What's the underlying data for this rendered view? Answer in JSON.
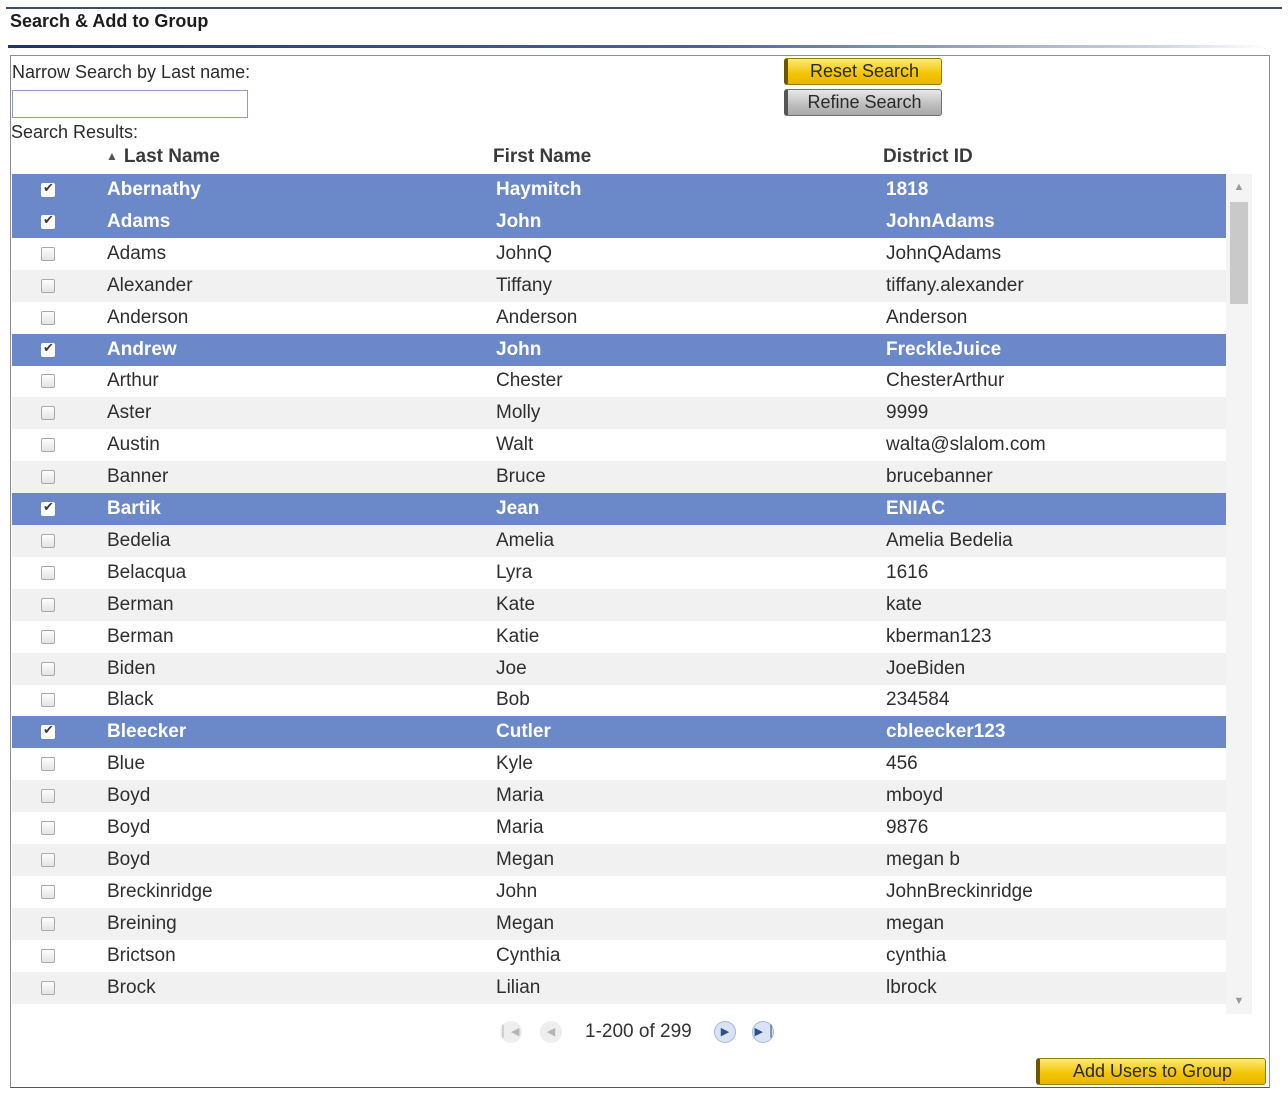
{
  "header": {
    "title": "Search & Add to Group"
  },
  "search": {
    "narrow_label": "Narrow Search by Last name:",
    "input_value": "",
    "reset_label": "Reset Search",
    "refine_label": "Refine Search",
    "results_label": "Search Results:"
  },
  "table": {
    "columns": [
      "Last Name",
      "First Name",
      "District ID"
    ],
    "sort_column": "Last Name",
    "sort_direction": "ascending",
    "rows": [
      {
        "last": "Abernathy",
        "first": "Haymitch",
        "id": "1818",
        "selected": true
      },
      {
        "last": "Adams",
        "first": "John",
        "id": "JohnAdams",
        "selected": true
      },
      {
        "last": "Adams",
        "first": "JohnQ",
        "id": "JohnQAdams",
        "selected": false
      },
      {
        "last": "Alexander",
        "first": "Tiffany",
        "id": "tiffany.alexander",
        "selected": false
      },
      {
        "last": "Anderson",
        "first": "Anderson",
        "id": "Anderson",
        "selected": false
      },
      {
        "last": "Andrew",
        "first": "John",
        "id": "FreckleJuice",
        "selected": true
      },
      {
        "last": "Arthur",
        "first": "Chester",
        "id": "ChesterArthur",
        "selected": false
      },
      {
        "last": "Aster",
        "first": "Molly",
        "id": "9999",
        "selected": false
      },
      {
        "last": "Austin",
        "first": "Walt",
        "id": "walta@slalom.com",
        "selected": false
      },
      {
        "last": "Banner",
        "first": "Bruce",
        "id": "brucebanner",
        "selected": false
      },
      {
        "last": "Bartik",
        "first": "Jean",
        "id": "ENIAC",
        "selected": true
      },
      {
        "last": "Bedelia",
        "first": "Amelia",
        "id": "Amelia Bedelia",
        "selected": false
      },
      {
        "last": "Belacqua",
        "first": "Lyra",
        "id": "1616",
        "selected": false
      },
      {
        "last": "Berman",
        "first": "Kate",
        "id": "kate",
        "selected": false
      },
      {
        "last": "Berman",
        "first": "Katie",
        "id": "kberman123",
        "selected": false
      },
      {
        "last": "Biden",
        "first": "Joe",
        "id": "JoeBiden",
        "selected": false
      },
      {
        "last": "Black",
        "first": "Bob",
        "id": "234584",
        "selected": false
      },
      {
        "last": "Bleecker",
        "first": "Cutler",
        "id": "cbleecker123",
        "selected": true
      },
      {
        "last": "Blue",
        "first": "Kyle",
        "id": "456",
        "selected": false
      },
      {
        "last": "Boyd",
        "first": "Maria",
        "id": "mboyd",
        "selected": false
      },
      {
        "last": "Boyd",
        "first": "Maria",
        "id": "9876",
        "selected": false
      },
      {
        "last": "Boyd",
        "first": "Megan",
        "id": "megan b",
        "selected": false
      },
      {
        "last": "Breckinridge",
        "first": "John",
        "id": "JohnBreckinridge",
        "selected": false
      },
      {
        "last": "Breining",
        "first": "Megan",
        "id": "megan",
        "selected": false
      },
      {
        "last": "Brictson",
        "first": "Cynthia",
        "id": "cynthia",
        "selected": false
      },
      {
        "last": "Brock",
        "first": "Lilian",
        "id": "lbrock",
        "selected": false
      }
    ]
  },
  "pager": {
    "range_text": "1-200 of 299"
  },
  "footer": {
    "add_label": "Add Users to Group"
  },
  "icons": {
    "sort": "sort-ascending-icon",
    "first": "first-page-icon",
    "prev": "previous-page-icon",
    "next": "next-page-icon",
    "last": "last-page-icon",
    "checkbox": "checkbox-icon"
  },
  "colors": {
    "selected_row": "#6b88c9",
    "button_yellow": "#f2c400",
    "button_gray": "#bdbdbd",
    "title_rule": "#1f3766"
  }
}
